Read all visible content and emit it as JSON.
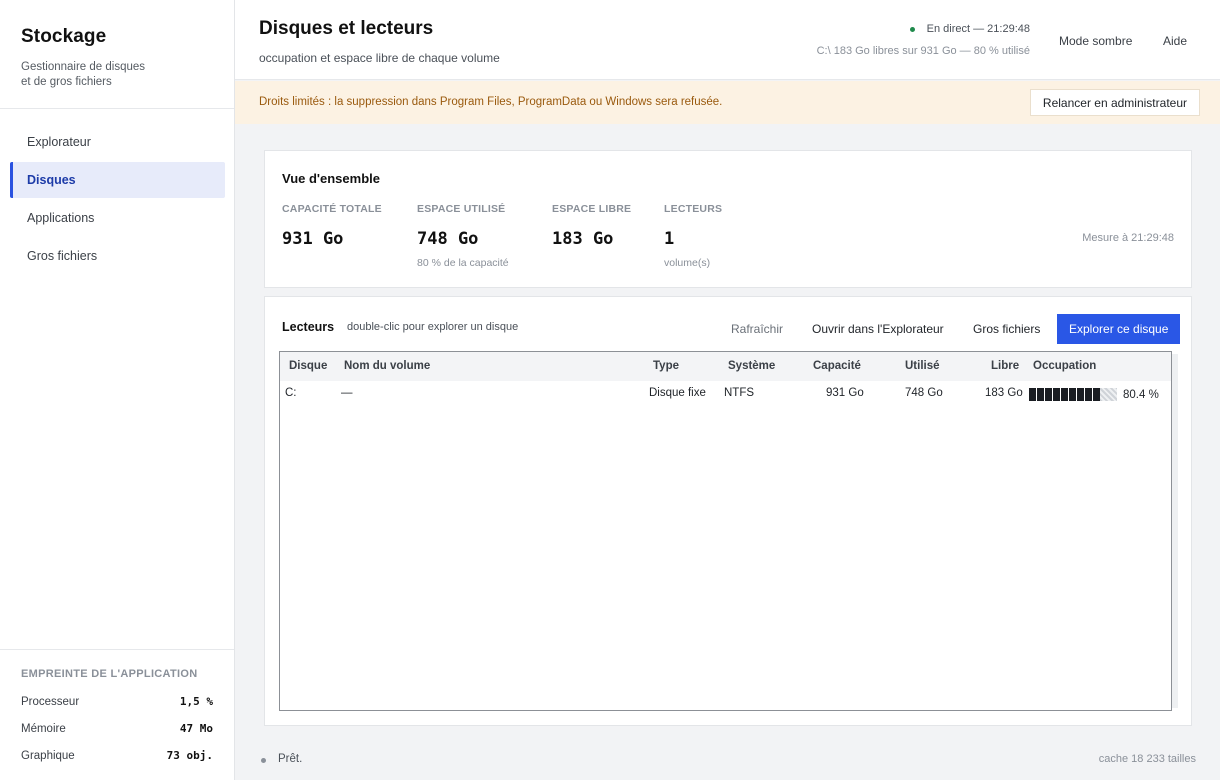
{
  "app": {
    "title": "Stockage",
    "subtitle": "Gestionnaire de disques et de gros fichiers"
  },
  "nav": {
    "items": [
      {
        "label": "Explorateur",
        "active": false
      },
      {
        "label": "Disques",
        "active": true
      },
      {
        "label": "Applications",
        "active": false
      },
      {
        "label": "Gros fichiers",
        "active": false
      }
    ]
  },
  "footprint": {
    "title": "EMPREINTE DE L'APPLICATION",
    "rows": [
      {
        "label": "Processeur",
        "value": "1,5 %"
      },
      {
        "label": "Mémoire",
        "value": "47 Mo"
      },
      {
        "label": "Graphique",
        "value": "73 obj."
      }
    ]
  },
  "header": {
    "title": "Disques et lecteurs",
    "subtitle": "occupation et espace libre de chaque volume",
    "live": "En direct — 21:29:48",
    "usage": "C:\\ 183 Go libres sur 931 Go — 80 % utilisé",
    "dark_mode": "Mode sombre",
    "help": "Aide"
  },
  "banner": {
    "text": "Droits limités : la suppression dans Program Files, ProgramData ou Windows sera refusée.",
    "button": "Relancer en administrateur"
  },
  "overview": {
    "title": "Vue d'ensemble",
    "stats": [
      {
        "label": "CAPACITÉ TOTALE",
        "value": "931 Go",
        "note": ""
      },
      {
        "label": "ESPACE UTILISÉ",
        "value": "748 Go",
        "note": "80 % de la capacité"
      },
      {
        "label": "ESPACE LIBRE",
        "value": "183 Go",
        "note": ""
      },
      {
        "label": "LECTEURS",
        "value": "1",
        "note": "volume(s)"
      }
    ],
    "measure": "Mesure à 21:29:48"
  },
  "drives": {
    "title": "Lecteurs",
    "hint": "double-clic pour explorer un disque",
    "toolbar": {
      "refresh": "Rafraîchir",
      "open_explorer": "Ouvrir dans l'Explorateur",
      "large_files": "Gros fichiers",
      "explore_disk": "Explorer ce disque"
    },
    "columns": [
      "Disque",
      "Nom du volume",
      "Type",
      "Système",
      "Capacité",
      "Utilisé",
      "Libre",
      "Occupation"
    ],
    "rows": [
      {
        "disk": "C:",
        "name": "—",
        "type": "Disque fixe",
        "fs": "NTFS",
        "capacity": "931 Go",
        "used": "748 Go",
        "free": "183 Go",
        "occupation": 0.804,
        "occupation_label": "80.4 %"
      }
    ]
  },
  "status": {
    "text": "Prêt.",
    "cache": "cache 18 233 tailles"
  },
  "colors": {
    "accent": "#2a57e6",
    "live": "#1f8a4c",
    "warning_bg": "#fcf2e3",
    "warning_text": "#9a5a0e"
  }
}
